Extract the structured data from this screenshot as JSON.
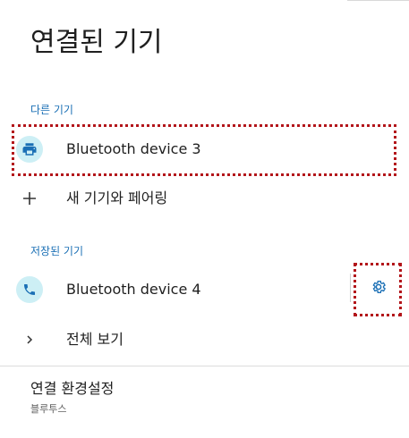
{
  "header": {
    "title": "연결된 기기"
  },
  "other_devices": {
    "section_label": "다른 기기",
    "items": [
      {
        "label": "Bluetooth device 3",
        "icon": "printer-icon"
      }
    ]
  },
  "pair_new": {
    "label": "새 기기와 페어링",
    "icon": "plus-icon"
  },
  "saved_devices": {
    "section_label": "저장된 기기",
    "items": [
      {
        "label": "Bluetooth device 4",
        "icon": "phone-icon",
        "settings_icon": "gear-icon"
      }
    ]
  },
  "see_all": {
    "label": "전체 보기",
    "icon": "chevron-right-icon"
  },
  "connection_prefs": {
    "title": "연결 환경설정",
    "subtitle": "블루투스"
  },
  "colors": {
    "accent": "#1a6fb5",
    "icon_bg": "#cdeff5",
    "highlight": "#b3161b"
  }
}
